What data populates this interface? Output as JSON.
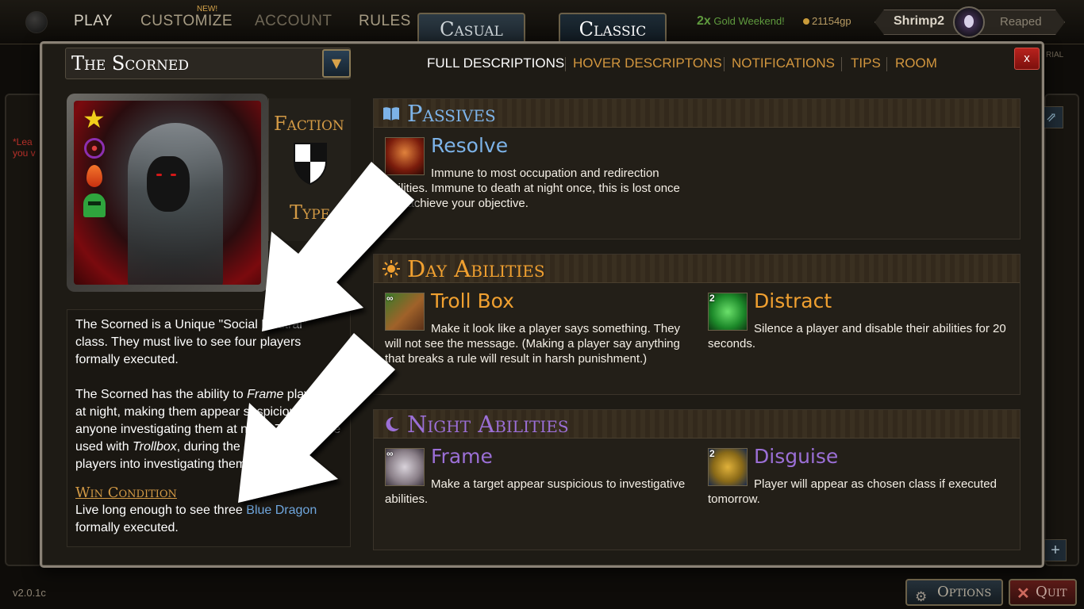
{
  "topbar": {
    "nav": [
      "PLAY",
      "CUSTOMIZE",
      "ACCOUNT",
      "RULES"
    ],
    "new_badge": "NEW!",
    "modes": [
      "Casual",
      "Classic"
    ],
    "gold_multiplier": "2x",
    "gold_weekend": "Gold Weekend!",
    "gold": "21154gp",
    "username": "Shrimp2",
    "status": "Reaped",
    "tutorial_fragment": "RIAL"
  },
  "background": {
    "red_text_1": "*Lea",
    "red_text_2": "you v"
  },
  "modal": {
    "class_name": "The Scorned",
    "tabs": [
      "FULL DESCRIPTIONS",
      "HOVER DESCRIPTONS",
      "NOTIFICATIONS",
      "TIPS",
      "ROOM"
    ],
    "close_label": "x",
    "faction_label": "Faction",
    "type_label": "Type",
    "description": {
      "p1": "The Scorned is a Unique \"Social Neutral\" class. They must live to see four players formally executed.",
      "p2_a": "The Scorned has the ability to ",
      "p2_frame": "Frame",
      "p2_b": " players at night, making them appear suspicious to anyone investigating them at night. This can be used with ",
      "p2_trollbox": "Trollbox",
      "p2_c": ", during the day to trick players into investigating them.",
      "win_title": "Win Condition",
      "win_a": "Live long enough to see three ",
      "win_player": "Blue Dragon",
      "win_b": " formally executed."
    },
    "sections": {
      "passives": {
        "title": "Passives",
        "abilities": [
          {
            "name": "Resolve",
            "text": "Immune to most occupation and redirection abilities. Immune to death at night once, this is lost once you achieve your objective."
          }
        ]
      },
      "day": {
        "title": "Day Abilities",
        "abilities": [
          {
            "name": "Troll Box",
            "count": "∞",
            "text": "Make it look like a player says something. They will not see the message. (Making a player say anything that breaks a rule will result in harsh punishment.)"
          },
          {
            "name": "Distract",
            "count": "2",
            "text": "Silence a player and disable their abilities for 20 seconds."
          }
        ]
      },
      "night": {
        "title": "Night Abilities",
        "abilities": [
          {
            "name": "Frame",
            "count": "∞",
            "text": "Make a target appear suspicious to investigative abilities."
          },
          {
            "name": "Disguise",
            "count": "2",
            "text": "Player will appear as chosen class if executed tomorrow."
          }
        ]
      }
    }
  },
  "footer": {
    "version": "v2.0.1c",
    "options": "Options",
    "quit": "Quit"
  },
  "colors": {
    "accent_orange": "#d39a45",
    "passive_blue": "#7db3e8",
    "day_orange": "#f0a030",
    "night_purple": "#9b6fd6",
    "link_blue": "#6fa6dd",
    "close_red": "#b8221d"
  },
  "icons": [
    "book-icon",
    "sun-icon",
    "moon-icon",
    "star-icon",
    "target-icon",
    "flame-icon",
    "helmet-icon",
    "shield-icon",
    "gear-icon"
  ]
}
